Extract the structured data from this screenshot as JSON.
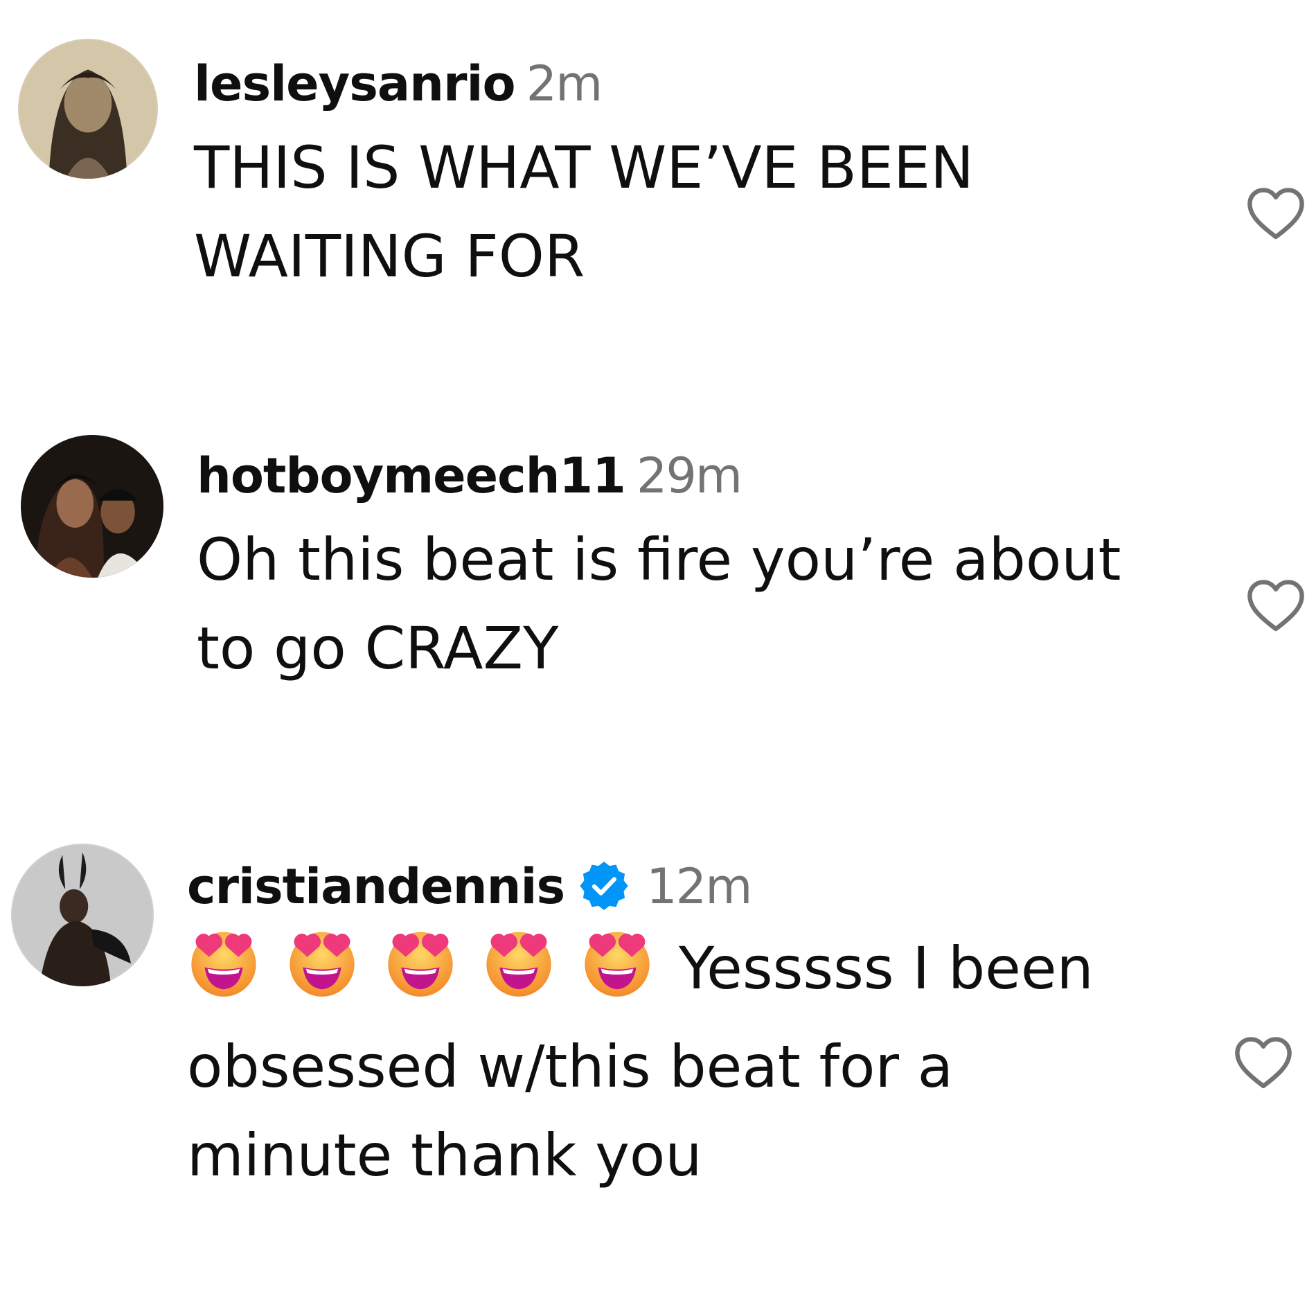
{
  "comments": [
    {
      "username": "lesleysanrio",
      "time": "2m",
      "verified": false,
      "lines": [
        "THIS IS WHAT WE’VE BEEN",
        "WAITING FOR"
      ]
    },
    {
      "username": "hotboymeech11",
      "time": "29m",
      "verified": false,
      "lines": [
        "Oh this beat is fire you’re about",
        "to go CRAZY"
      ]
    },
    {
      "username": "cristiandennis",
      "time": "12m",
      "verified": true,
      "emoji_icon": "smiling-face-with-heart-eyes",
      "emoji_count": 5,
      "lines": [
        "Yesssss I been",
        "obsessed w/this beat for a",
        "minute thank you"
      ]
    }
  ],
  "icons": {
    "like": "heart-outline-icon",
    "verified": "verified-badge-icon"
  },
  "colors": {
    "text": "#0f0f0f",
    "muted": "#737373",
    "verified": "#0095f6",
    "heart_outline": "#737373"
  }
}
